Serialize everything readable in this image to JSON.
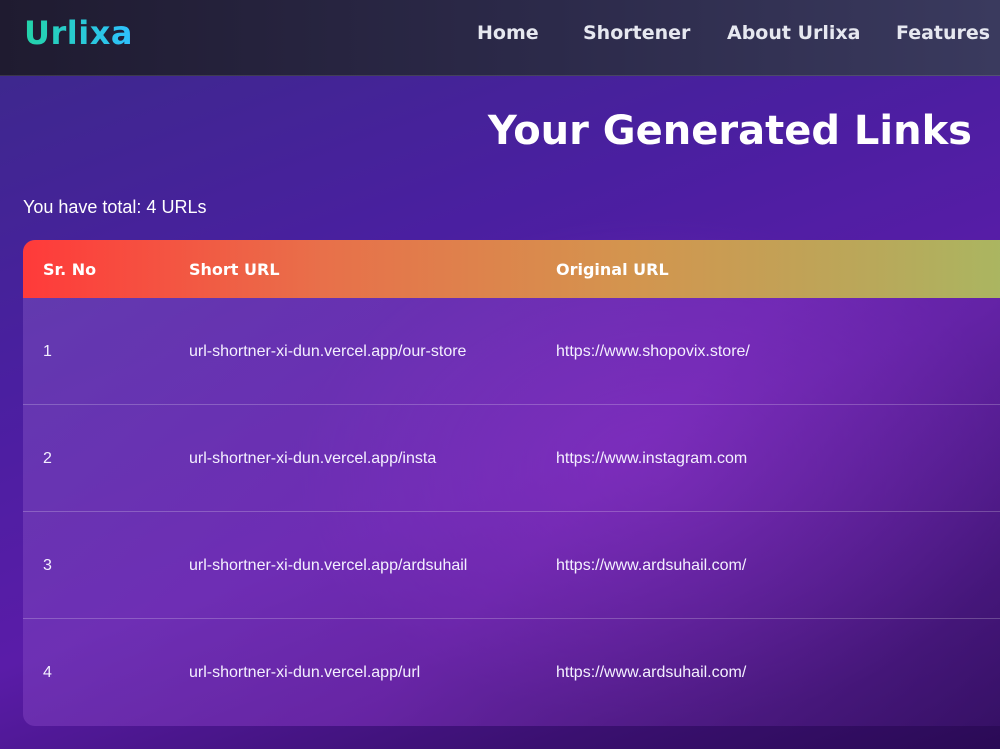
{
  "navbar": {
    "brand": "Urlixa",
    "links": [
      "Home",
      "Shortener",
      "About Urlixa",
      "Features"
    ]
  },
  "page": {
    "title": "Your Generated Links",
    "total_text": "You have total: 4 URLs"
  },
  "table": {
    "headers": [
      "Sr. No",
      "Short URL",
      "Original URL"
    ],
    "rows": [
      {
        "sr": "1",
        "short_url": "url-shortner-xi-dun.vercel.app/our-store",
        "original_url": "https://www.shopovix.store/"
      },
      {
        "sr": "2",
        "short_url": "url-shortner-xi-dun.vercel.app/insta",
        "original_url": "https://www.instagram.com"
      },
      {
        "sr": "3",
        "short_url": "url-shortner-xi-dun.vercel.app/ardsuhail",
        "original_url": "https://www.ardsuhail.com/"
      },
      {
        "sr": "4",
        "short_url": "url-shortner-xi-dun.vercel.app/url",
        "original_url": "https://www.ardsuhail.com/"
      }
    ]
  },
  "colors": {
    "brand_gradient": [
      "#23d3a8",
      "#2fc0ff"
    ],
    "header_gradient": [
      "#ff3a3a",
      "#a8b862"
    ],
    "background": "#4a1fa0"
  }
}
